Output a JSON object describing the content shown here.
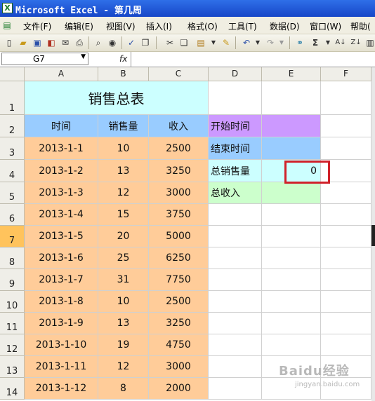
{
  "window": {
    "title": "Microsoft Excel - 第几周"
  },
  "menu": [
    "文件(F)",
    "编辑(E)",
    "视图(V)",
    "插入(I)",
    "格式(O)",
    "工具(T)",
    "数据(D)",
    "窗口(W)",
    "帮助("
  ],
  "formula_bar": {
    "name_box": "G7",
    "fx_label": "fx",
    "content": ""
  },
  "columns": [
    "A",
    "B",
    "C",
    "D",
    "E",
    "F"
  ],
  "rows": [
    "1",
    "2",
    "3",
    "4",
    "5",
    "6",
    "7",
    "8",
    "9",
    "10",
    "11",
    "12",
    "13",
    "14"
  ],
  "selected_row": "7",
  "sheet": {
    "title": "销售总表",
    "headers": [
      "时间",
      "销售量",
      "收入"
    ],
    "data": [
      [
        "2013-1-1",
        "10",
        "2500"
      ],
      [
        "2013-1-2",
        "13",
        "3250"
      ],
      [
        "2013-1-3",
        "12",
        "3000"
      ],
      [
        "2013-1-4",
        "15",
        "3750"
      ],
      [
        "2013-1-5",
        "20",
        "5000"
      ],
      [
        "2013-1-6",
        "25",
        "6250"
      ],
      [
        "2013-1-7",
        "31",
        "7750"
      ],
      [
        "2013-1-8",
        "10",
        "2500"
      ],
      [
        "2013-1-9",
        "13",
        "3250"
      ],
      [
        "2013-1-10",
        "19",
        "4750"
      ],
      [
        "2013-1-11",
        "12",
        "3000"
      ],
      [
        "2013-1-12",
        "8",
        "2000"
      ]
    ],
    "summary_labels": [
      "开始时间",
      "结束时间",
      "总销售量",
      "总收入"
    ],
    "total_sales_value": "0"
  },
  "colors": {
    "title_fill": "#ccffff",
    "header_fill": "#99ccff",
    "data_fill": "#ffcc99",
    "start_fill": "#cc99ff",
    "end_fill": "#99ccff",
    "total_sales_fill": "#ccffff",
    "total_income_fill": "#ccffcc",
    "highlight_border": "#d0212a"
  },
  "watermark": {
    "line1": "Baidu经验",
    "line2": "jingyan.baidu.com"
  }
}
